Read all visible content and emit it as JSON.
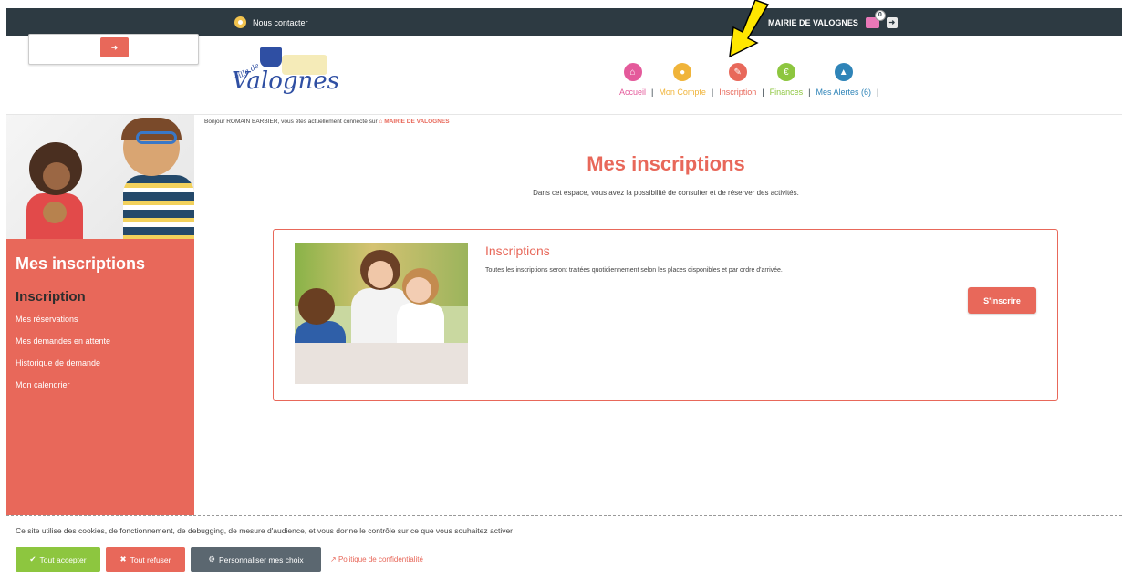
{
  "topbar": {
    "contact_label": "Nous contacter",
    "mairie_label": "MAIRIE DE VALOGNES",
    "cart_count": "0"
  },
  "logo": {
    "small_text": "ville de",
    "word": "Valognes"
  },
  "nav": {
    "items": [
      {
        "label": "Accueil",
        "color": "#e45a9b",
        "icon": "home-icon"
      },
      {
        "label": "Mon Compte",
        "color": "#f0b43a",
        "icon": "user-icon"
      },
      {
        "label": "Inscription",
        "color": "#e8685a",
        "icon": "pencil-icon"
      },
      {
        "label": "Finances",
        "color": "#8dc63f",
        "icon": "euro-icon"
      },
      {
        "label": "Mes Alertes (6)",
        "color": "#2f84b8",
        "icon": "alert-icon"
      }
    ]
  },
  "greeting": {
    "prefix": "Bonjour ROMAIN BARBIER, vous êtes actuellement connecté sur",
    "place": "MAIRIE DE VALOGNES"
  },
  "main": {
    "title": "Mes inscriptions",
    "description": "Dans cet espace, vous avez la possibilité de consulter et de réserver des activités."
  },
  "sidebar": {
    "title": "Mes inscriptions",
    "subtitle": "Inscription",
    "links": [
      "Mes réservations",
      "Mes demandes en attente",
      "Historique de demande",
      "Mon calendrier"
    ]
  },
  "card": {
    "title": "Inscriptions",
    "text": "Toutes les inscriptions seront traitées quotidiennement selon les places disponibles et par ordre d'arrivée.",
    "button": "S'inscrire"
  },
  "cookie": {
    "text": "Ce site utilise des cookies, de fonctionnement, de debugging, de mesure d'audience, et vous donne le contrôle sur ce que vous souhaitez activer",
    "accept": "Tout accepter",
    "refuse": "Tout refuser",
    "custom": "Personnaliser mes choix",
    "policy": "Politique de confidentialité"
  },
  "colors": {
    "accent": "#e8685a",
    "topbar": "#2d3a42",
    "annotation_arrow": "#ffe600"
  }
}
